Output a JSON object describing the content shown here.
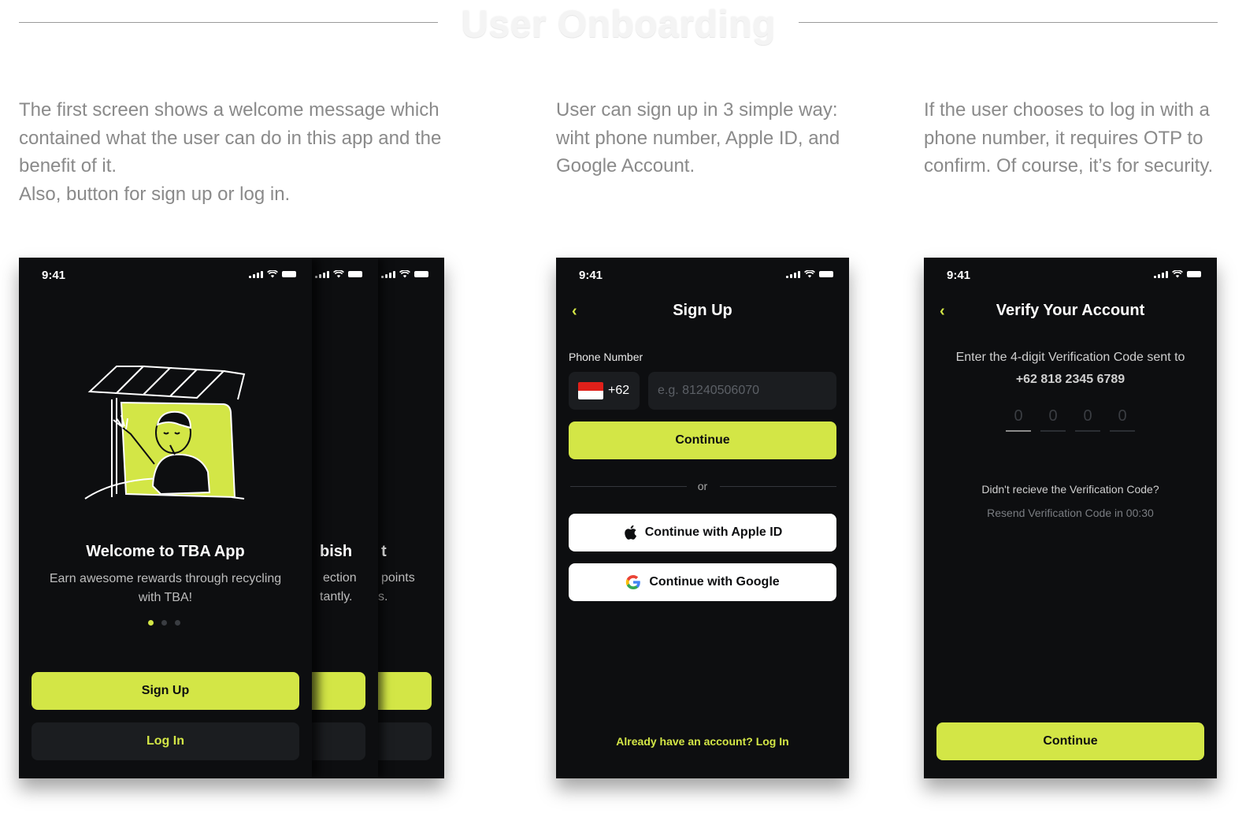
{
  "header": {
    "title": "User Onboarding"
  },
  "descriptions": {
    "welcome": [
      "The first screen shows a welcome message which contained what the user can do in this app and the benefit of it.",
      "Also, button for sign up or log in."
    ],
    "signup": "User can sign up in 3 simple way: wiht phone number, Apple ID, and Google Account.",
    "verify": "If the user chooses to log in with a phone number, it requires OTP to confirm. Of course, it’s for security."
  },
  "status": {
    "time": "9:41"
  },
  "welcome_screen": {
    "title": "Welcome to TBA App",
    "subtitle": "Earn awesome rewards through recycling with TBA!",
    "back_title_1": "bish",
    "back_sub_1a": "ection",
    "back_sub_1b": "tantly.",
    "back_title_2": "t",
    "back_sub_2a": "points",
    "back_sub_2b": "s.",
    "signup_label": "Sign Up",
    "login_label": "Log In",
    "page_dots": 3,
    "active_dot": 0
  },
  "signup_screen": {
    "title": "Sign Up",
    "phone_label": "Phone Number",
    "country_code": "+62",
    "phone_placeholder": "e.g. 81240506070",
    "continue_label": "Continue",
    "or_label": "or",
    "apple_label": "Continue with Apple ID",
    "google_label": "Continue with Google",
    "login_prompt": "Already have an account? Log In"
  },
  "verify_screen": {
    "title": "Verify Your Account",
    "instruction": "Enter the 4-digit Verification Code sent to",
    "phone": "+62 818 2345 6789",
    "otp_digits": [
      "0",
      "0",
      "0",
      "0"
    ],
    "not_received": "Didn't recieve the Verification Code?",
    "resend": "Resend Verification Code in 00:30",
    "continue_label": "Continue"
  },
  "colors": {
    "accent": "#d3e646",
    "screen_bg": "#0d0e10",
    "field_bg": "#1b1d20"
  }
}
